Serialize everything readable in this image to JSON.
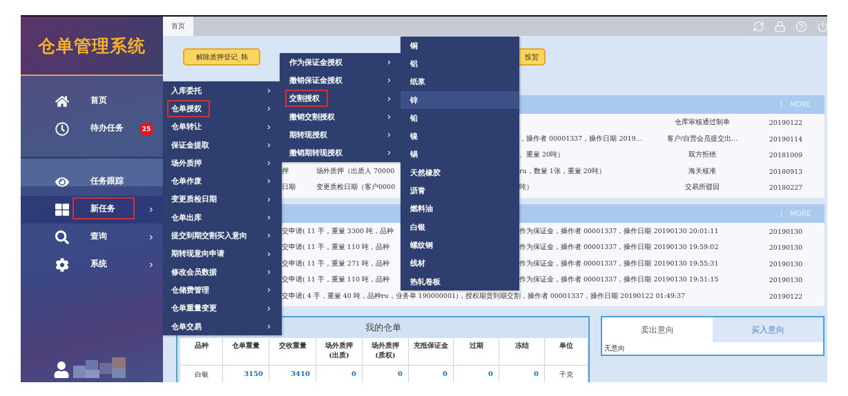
{
  "sidebar": {
    "title": "仓单管理系统",
    "groups": [
      {
        "items": [
          {
            "label": "首页",
            "selected": false,
            "has_submenu": false
          },
          {
            "label": "待办任务",
            "badge": "25",
            "selected": false,
            "has_submenu": false
          }
        ]
      },
      {
        "items": [
          {
            "label": "任务跟踪",
            "selected": false,
            "has_submenu": false
          },
          {
            "label": "新任务",
            "selected": true,
            "has_submenu": true
          },
          {
            "label": "查询",
            "selected": false,
            "has_submenu": true
          },
          {
            "label": "系统",
            "selected": false,
            "has_submenu": true
          }
        ]
      }
    ]
  },
  "tabs": [
    {
      "label": "首页",
      "selected": true
    }
  ],
  "toolbar_buttons": [
    {
      "label": "解除质押登记_韩"
    },
    {
      "label": "投贸"
    }
  ],
  "menus": [
    {
      "boxed_selection": true,
      "items": [
        {
          "label": "入库委托",
          "selected": false,
          "has_submenu": true
        },
        {
          "label": "仓单授权",
          "selected": true,
          "has_submenu": true
        },
        {
          "label": "仓单转让",
          "selected": false,
          "has_submenu": true
        },
        {
          "label": "保证金提取",
          "selected": false,
          "has_submenu": true
        },
        {
          "label": "场外质押",
          "selected": false,
          "has_submenu": true
        },
        {
          "label": "仓单作废",
          "selected": false,
          "has_submenu": true
        },
        {
          "label": "变更质检日期",
          "selected": false,
          "has_submenu": true
        },
        {
          "label": "仓单出库",
          "selected": false,
          "has_submenu": true
        },
        {
          "label": "提交到期交割买入意向",
          "selected": false,
          "has_submenu": true
        },
        {
          "label": "期转现意向申请",
          "selected": false,
          "has_submenu": true
        },
        {
          "label": "修改会员数据",
          "selected": false,
          "has_submenu": true
        },
        {
          "label": "仓储费管理",
          "selected": false,
          "has_submenu": true
        },
        {
          "label": "仓单重量变更",
          "selected": false,
          "has_submenu": true
        },
        {
          "label": "仓单交易",
          "selected": false,
          "has_submenu": true
        }
      ]
    },
    {
      "boxed_selection": true,
      "items": [
        {
          "label": "作为保证金授权",
          "selected": false,
          "has_submenu": true
        },
        {
          "label": "撤销保证金授权",
          "selected": false,
          "has_submenu": true
        },
        {
          "label": "交割授权",
          "selected": true,
          "has_submenu": true
        },
        {
          "label": "撤销交割授权",
          "selected": false,
          "has_submenu": true
        },
        {
          "label": "期转现授权",
          "selected": false,
          "has_submenu": true
        },
        {
          "label": "撤销期转现授权",
          "selected": false,
          "has_submenu": true
        }
      ]
    },
    {
      "boxed_selection": false,
      "items": [
        {
          "label": "铜",
          "selected": false,
          "has_submenu": false
        },
        {
          "label": "铝",
          "selected": false,
          "has_submenu": false
        },
        {
          "label": "纸浆",
          "selected": false,
          "has_submenu": false
        },
        {
          "label": "锌",
          "selected": true,
          "has_submenu": false
        },
        {
          "label": "铅",
          "selected": false,
          "has_submenu": false
        },
        {
          "label": "镍",
          "selected": false,
          "has_submenu": false
        },
        {
          "label": "锡",
          "selected": false,
          "has_submenu": false
        },
        {
          "label": "天然橡胶",
          "selected": false,
          "has_submenu": false
        },
        {
          "label": "沥青",
          "selected": false,
          "has_submenu": false
        },
        {
          "label": "燃料油",
          "selected": false,
          "has_submenu": false
        },
        {
          "label": "白银",
          "selected": false,
          "has_submenu": false
        },
        {
          "label": "螺纹钢",
          "selected": false,
          "has_submenu": false
        },
        {
          "label": "线材",
          "selected": false,
          "has_submenu": false
        },
        {
          "label": "热轧卷板",
          "selected": false,
          "has_submenu": false
        }
      ]
    }
  ],
  "panels": [
    {
      "more": "MORE",
      "rows": [
        {
          "kind": "split",
          "status": "仓库审核通过制单",
          "date": "20190122"
        },
        {
          "kind": "split",
          "right": "，操作者 00001337，操作日期 2019…",
          "status": "客户/自营会员提交出…",
          "date": "20190114"
        },
        {
          "kind": "split",
          "right": "、重量 20吨）",
          "status": "双方拒绝",
          "date": "20181009"
        },
        {
          "kind": "split",
          "lead": "押",
          "left": "场外质押（出质人 70000",
          "right": "ru，数量 1张，重量 20吨）",
          "status": "海关核准",
          "date": "20180913"
        },
        {
          "kind": "split",
          "lead": "日期",
          "left": "变更质检日期（客户0000",
          "right": "吨）",
          "status": "交易所驳回",
          "date": "20180227"
        }
      ]
    },
    {
      "more": "MORE",
      "rows": [
        {
          "kind": "split",
          "left": "交申请( 11 手，重量 3300 吨，品种",
          "right": "作为保证金，操作者 00001337，操作日期 20190130 20:01:11",
          "date": "20190130"
        },
        {
          "kind": "split",
          "left": "交申请( 11 手，重量 110 吨，品种",
          "right": "作为保证金，操作者 00001337，操作日期 20190130 19:59:02",
          "date": "20190130"
        },
        {
          "kind": "split",
          "left": "交申请( 11 手，重量 271 吨，品种",
          "right": "作为保证金，操作者 00001337，操作日期 20190130 19:55:31",
          "date": "20190130"
        },
        {
          "kind": "split",
          "left": "交申请( 11 手，重量 110 吨，品种",
          "right": "作为保证金，操作者 00001337，操作日期 20190130 19:51:15",
          "date": "20190130"
        },
        {
          "kind": "full",
          "text": "交申请( 4 手，重量 40 吨，品种ru，业务单 190000001)，授权期货到期交割，操作者 00001337，操作日期 20190122 01:49:37",
          "date": "20190122"
        }
      ]
    }
  ],
  "warehouse_receipts": {
    "title": "我的仓单",
    "columns": [
      "品种",
      "仓单重量",
      "交收重量",
      "场外质押(出质)",
      "场外质押(质权)",
      "充抵保证金",
      "过期",
      "冻结",
      "单位"
    ],
    "rows": [
      [
        "白银",
        "3150",
        "3410",
        "0",
        "0",
        "0",
        "0",
        "0",
        "千克"
      ]
    ]
  },
  "intentions": {
    "tabs": [
      {
        "label": "卖出意向",
        "selected": true
      },
      {
        "label": "买入意向",
        "selected": false
      }
    ],
    "content": "无意向"
  }
}
